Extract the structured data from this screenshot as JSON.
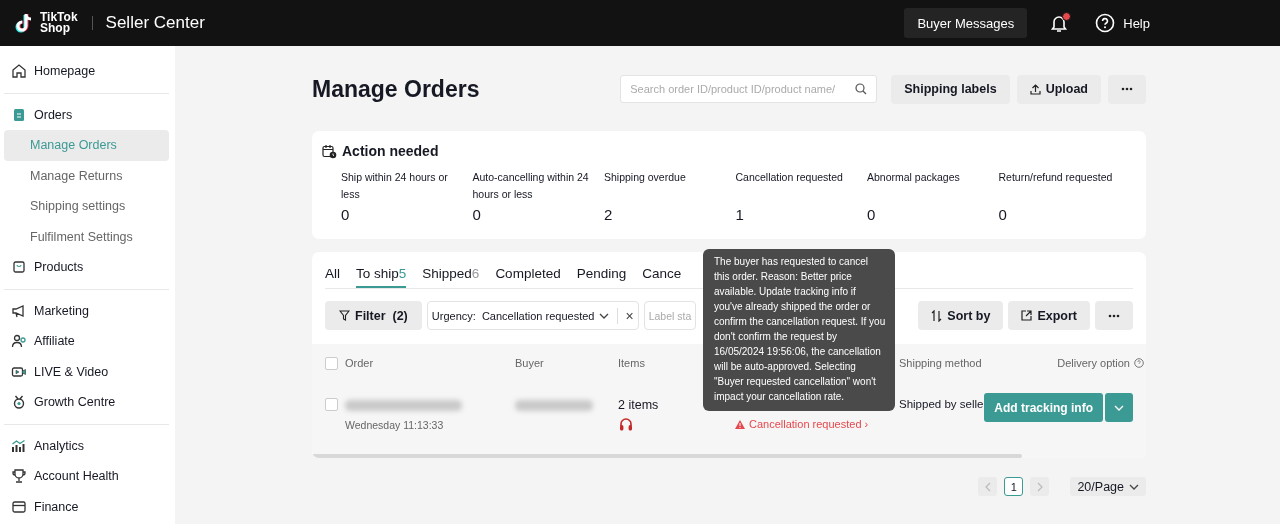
{
  "header": {
    "logo_lines": [
      "TikTok",
      "Shop"
    ],
    "title": "Seller Center",
    "messages_button": "Buyer Messages",
    "has_unread_notifications": true,
    "help": "Help"
  },
  "sidebar": {
    "groups": [
      {
        "items": [
          {
            "label": "Homepage",
            "selected": false
          }
        ]
      },
      {
        "items": [
          {
            "label": "Orders",
            "selected": false,
            "children": [
              {
                "label": "Manage Orders",
                "selected": true
              },
              {
                "label": "Manage Returns",
                "selected": false
              },
              {
                "label": "Shipping settings",
                "selected": false
              },
              {
                "label": "Fulfilment Settings",
                "selected": false
              }
            ]
          },
          {
            "label": "Products",
            "selected": false
          }
        ]
      },
      {
        "items": [
          {
            "label": "Marketing",
            "selected": false
          },
          {
            "label": "Affiliate",
            "selected": false
          },
          {
            "label": "LIVE & Video",
            "selected": false
          },
          {
            "label": "Growth Centre",
            "selected": false
          }
        ]
      },
      {
        "items": [
          {
            "label": "Analytics",
            "selected": false
          },
          {
            "label": "Account Health",
            "selected": false
          },
          {
            "label": "Finance",
            "selected": false
          }
        ]
      }
    ]
  },
  "page": {
    "title": "Manage Orders",
    "search": {
      "placeholder": "Search order ID/product ID/product name/"
    },
    "buttons": [
      "Shipping labels",
      "Upload"
    ]
  },
  "action_needed": {
    "title": "Action needed",
    "stats": [
      {
        "label": "Ship within 24 hours or less",
        "value": "0"
      },
      {
        "label": "Auto-cancelling within 24 hours or less",
        "value": "0"
      },
      {
        "label": "Shipping overdue",
        "value": "2"
      },
      {
        "label": "Cancellation requested",
        "value": "1"
      },
      {
        "label": "Abnormal packages",
        "value": "0"
      },
      {
        "label": "Return/refund requested",
        "value": "0"
      }
    ]
  },
  "tabs": [
    {
      "label": "All",
      "selected": false
    },
    {
      "label": "To ship",
      "count": "5",
      "selected": true
    },
    {
      "label": "Shipped",
      "count": "6",
      "selected": false
    },
    {
      "label": "Completed",
      "selected": false
    },
    {
      "label": "Pending",
      "selected": false
    },
    {
      "label": "Cance",
      "selected": false
    }
  ],
  "filters": {
    "filter_button": "Filter",
    "filter_count": "(2)",
    "urgency_label": "Urgency:",
    "urgency_value": "Cancellation requested",
    "clear_icon": "×",
    "label_status_placeholder": "Label sta",
    "sort_button": "Sort by",
    "export_button": "Export"
  },
  "table": {
    "select_all_checked": false,
    "columns": [
      "Order",
      "Buyer",
      "Items",
      "Shipping method",
      "Delivery option"
    ],
    "rows": [
      {
        "checked": false,
        "order_date": "Wednesday 11:13:33",
        "items": "2 items",
        "status": "Cancellation requested ›",
        "shipping_method": "Shipped by selle",
        "action": "Add tracking info"
      }
    ]
  },
  "tooltip": "The buyer has requested to cancel this order. Reason: Better price available. Update tracking info if you've already shipped the order or confirm the cancellation request. If you don't confirm the request by 16/05/2024 19:56:06, the cancellation will be auto-approved. Selecting \"Buyer requested cancellation\" won't impact your cancellation rate.",
  "pagination": {
    "pages": [
      {
        "label": "1",
        "selected": true
      }
    ],
    "page_size": "20/Page"
  }
}
